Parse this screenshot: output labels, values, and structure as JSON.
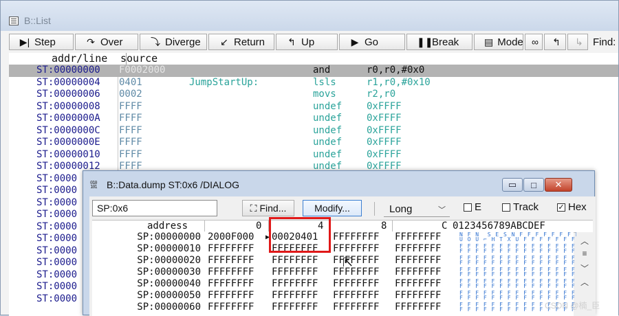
{
  "list_window": {
    "title": "B::List",
    "toolbar": [
      {
        "label": "Step",
        "icon": "step-icon"
      },
      {
        "label": "Over",
        "icon": "step-over-icon"
      },
      {
        "label": "Diverge",
        "icon": "diverge-icon"
      },
      {
        "label": "Return",
        "icon": "return-icon"
      },
      {
        "label": "Up",
        "icon": "up-icon"
      },
      {
        "label": "Go",
        "icon": "go-icon"
      },
      {
        "label": "Break",
        "icon": "break-icon"
      },
      {
        "label": "Mode",
        "icon": "mode-icon"
      }
    ],
    "find_label": "Find:",
    "columns": {
      "addr": "addr/line",
      "source": "source"
    },
    "rows": [
      {
        "addr": "ST:00000000",
        "src": "F0002000",
        "label": "",
        "mnem": "and",
        "ops": "r0,r0,#0x0"
      },
      {
        "addr": "ST:00000004",
        "src": "0401",
        "label": "JumpStartUp:",
        "mnem": "lsls",
        "ops": "r1,r0,#0x10"
      },
      {
        "addr": "ST:00000006",
        "src": "0002",
        "label": "",
        "mnem": "movs",
        "ops": "r2,r0"
      },
      {
        "addr": "ST:00000008",
        "src": "FFFF",
        "label": "",
        "mnem": "undef",
        "ops": "0xFFFF"
      },
      {
        "addr": "ST:0000000A",
        "src": "FFFF",
        "label": "",
        "mnem": "undef",
        "ops": "0xFFFF"
      },
      {
        "addr": "ST:0000000C",
        "src": "FFFF",
        "label": "",
        "mnem": "undef",
        "ops": "0xFFFF"
      },
      {
        "addr": "ST:0000000E",
        "src": "FFFF",
        "label": "",
        "mnem": "undef",
        "ops": "0xFFFF"
      },
      {
        "addr": "ST:00000010",
        "src": "FFFF",
        "label": "",
        "mnem": "undef",
        "ops": "0xFFFF"
      },
      {
        "addr": "ST:00000012",
        "src": "FFFF",
        "label": "",
        "mnem": "undef",
        "ops": "0xFFFF"
      },
      {
        "addr": "ST:0000",
        "src": "",
        "label": "",
        "mnem": "",
        "ops": ""
      },
      {
        "addr": "ST:0000",
        "src": "",
        "label": "",
        "mnem": "",
        "ops": ""
      },
      {
        "addr": "ST:0000",
        "src": "",
        "label": "",
        "mnem": "",
        "ops": ""
      },
      {
        "addr": "ST:0000",
        "src": "",
        "label": "",
        "mnem": "",
        "ops": ""
      },
      {
        "addr": "ST:0000",
        "src": "",
        "label": "",
        "mnem": "",
        "ops": ""
      },
      {
        "addr": "ST:0000",
        "src": "",
        "label": "",
        "mnem": "",
        "ops": ""
      },
      {
        "addr": "ST:0000",
        "src": "",
        "label": "",
        "mnem": "",
        "ops": ""
      },
      {
        "addr": "ST:0000",
        "src": "",
        "label": "",
        "mnem": "",
        "ops": ""
      },
      {
        "addr": "ST:0000",
        "src": "",
        "label": "",
        "mnem": "",
        "ops": ""
      },
      {
        "addr": "ST:0000",
        "src": "",
        "label": "",
        "mnem": "",
        "ops": ""
      },
      {
        "addr": "ST:0000",
        "src": "",
        "label": "",
        "mnem": "",
        "ops": ""
      }
    ]
  },
  "dialog": {
    "title": "B::Data.dump ST:0x6 /DIALOG",
    "icon_text": "010 101",
    "address_value": "SP:0x6",
    "find_label": "Find...",
    "modify_label": "Modify...",
    "format_value": "Long",
    "checkboxes": [
      {
        "label": "E",
        "checked": false
      },
      {
        "label": "Track",
        "checked": false
      },
      {
        "label": "Hex",
        "checked": true
      }
    ],
    "columns": {
      "address": "address",
      "c0": "0",
      "c4": "4",
      "c8": "8",
      "cc": "C",
      "ascii": "0123456789ABCDEF"
    },
    "rows": [
      {
        "addr": "SP:00000000",
        "c0": "2000F000",
        "c4": "00020401",
        "c8": "FFFFFFFF",
        "cc": "FFFFFFFF",
        "ascii": "N F N  S E S N F F F F F F F F\nU O U ⌐ H T X U F F F F F F F F"
      },
      {
        "addr": "SP:00000010",
        "c0": "FFFFFFFF",
        "c4": "FFFFFFFF",
        "c8": "FFFFFFFF",
        "cc": "FFFFFFFF",
        "ascii": "F F F F F F F F F F F F F F F F\nF F F F F F F F F F F F F F F F"
      },
      {
        "addr": "SP:00000020",
        "c0": "FFFFFFFF",
        "c4": "FFFFFFFF",
        "c8": "FFFFFFFF",
        "cc": "FFFFFFFF",
        "ascii": "F F F F F F F F F F F F F F F F\nF F F F F F F F F F F F F F F F"
      },
      {
        "addr": "SP:00000030",
        "c0": "FFFFFFFF",
        "c4": "FFFFFFFF",
        "c8": "FFFFFFFF",
        "cc": "FFFFFFFF",
        "ascii": "F F F F F F F F F F F F F F F F\nF F F F F F F F F F F F F F F F"
      },
      {
        "addr": "SP:00000040",
        "c0": "FFFFFFFF",
        "c4": "FFFFFFFF",
        "c8": "FFFFFFFF",
        "cc": "FFFFFFFF",
        "ascii": "F F F F F F F F F F F F F F F F\nF F F F F F F F F F F F F F F F"
      },
      {
        "addr": "SP:00000050",
        "c0": "FFFFFFFF",
        "c4": "FFFFFFFF",
        "c8": "FFFFFFFF",
        "cc": "FFFFFFFF",
        "ascii": "F F F F F F F F F F F F F F F F\nF F F F F F F F F F F F F F F F"
      },
      {
        "addr": "SP:00000060",
        "c0": "FFFFFFFF",
        "c4": "FFFFFFFF",
        "c8": "FFFFFFFF",
        "cc": "FFFFFFFF",
        "ascii": "F F F F F F F F F F F F F F F F\nF F F F F F F F F F F F F F F F"
      }
    ]
  },
  "watermark": "CSDN @楠_臣",
  "colors": {
    "highlight_box": "#e01818",
    "selected_row": "#b3b3b3",
    "disasm": "#2aa39a",
    "addr": "#1a1a8c"
  }
}
